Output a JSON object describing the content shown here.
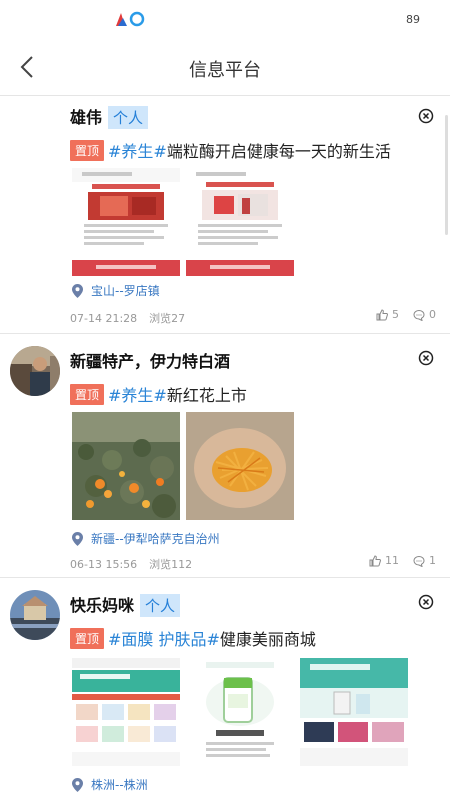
{
  "status_bar": {
    "battery": "89",
    "logo_icon": "app-logo-icon"
  },
  "header": {
    "title": "信息平台",
    "back_icon": "chevron-left-icon"
  },
  "posts": [
    {
      "name": "雄伟",
      "badge": "个人",
      "pin": "置顶",
      "tag": "#养生#",
      "text": "端粒酶开启健康每一天的新生活",
      "location": "宝山--罗店镇",
      "time": "07-14 21:28",
      "views": "浏览27",
      "likes": "5",
      "comments": "0"
    },
    {
      "name": "新疆特产，伊力特白酒",
      "pin": "置顶",
      "tag": "#养生#",
      "text": "新红花上市",
      "location": "新疆--伊犁哈萨克自治州",
      "time": "06-13 15:56",
      "views": "浏览112",
      "likes": "11",
      "comments": "1"
    },
    {
      "name": "快乐妈咪",
      "badge": "个人",
      "pin": "置顶",
      "tag": "#面膜 护肤品#",
      "text": "健康美丽商城",
      "location": "株洲--株洲"
    }
  ]
}
